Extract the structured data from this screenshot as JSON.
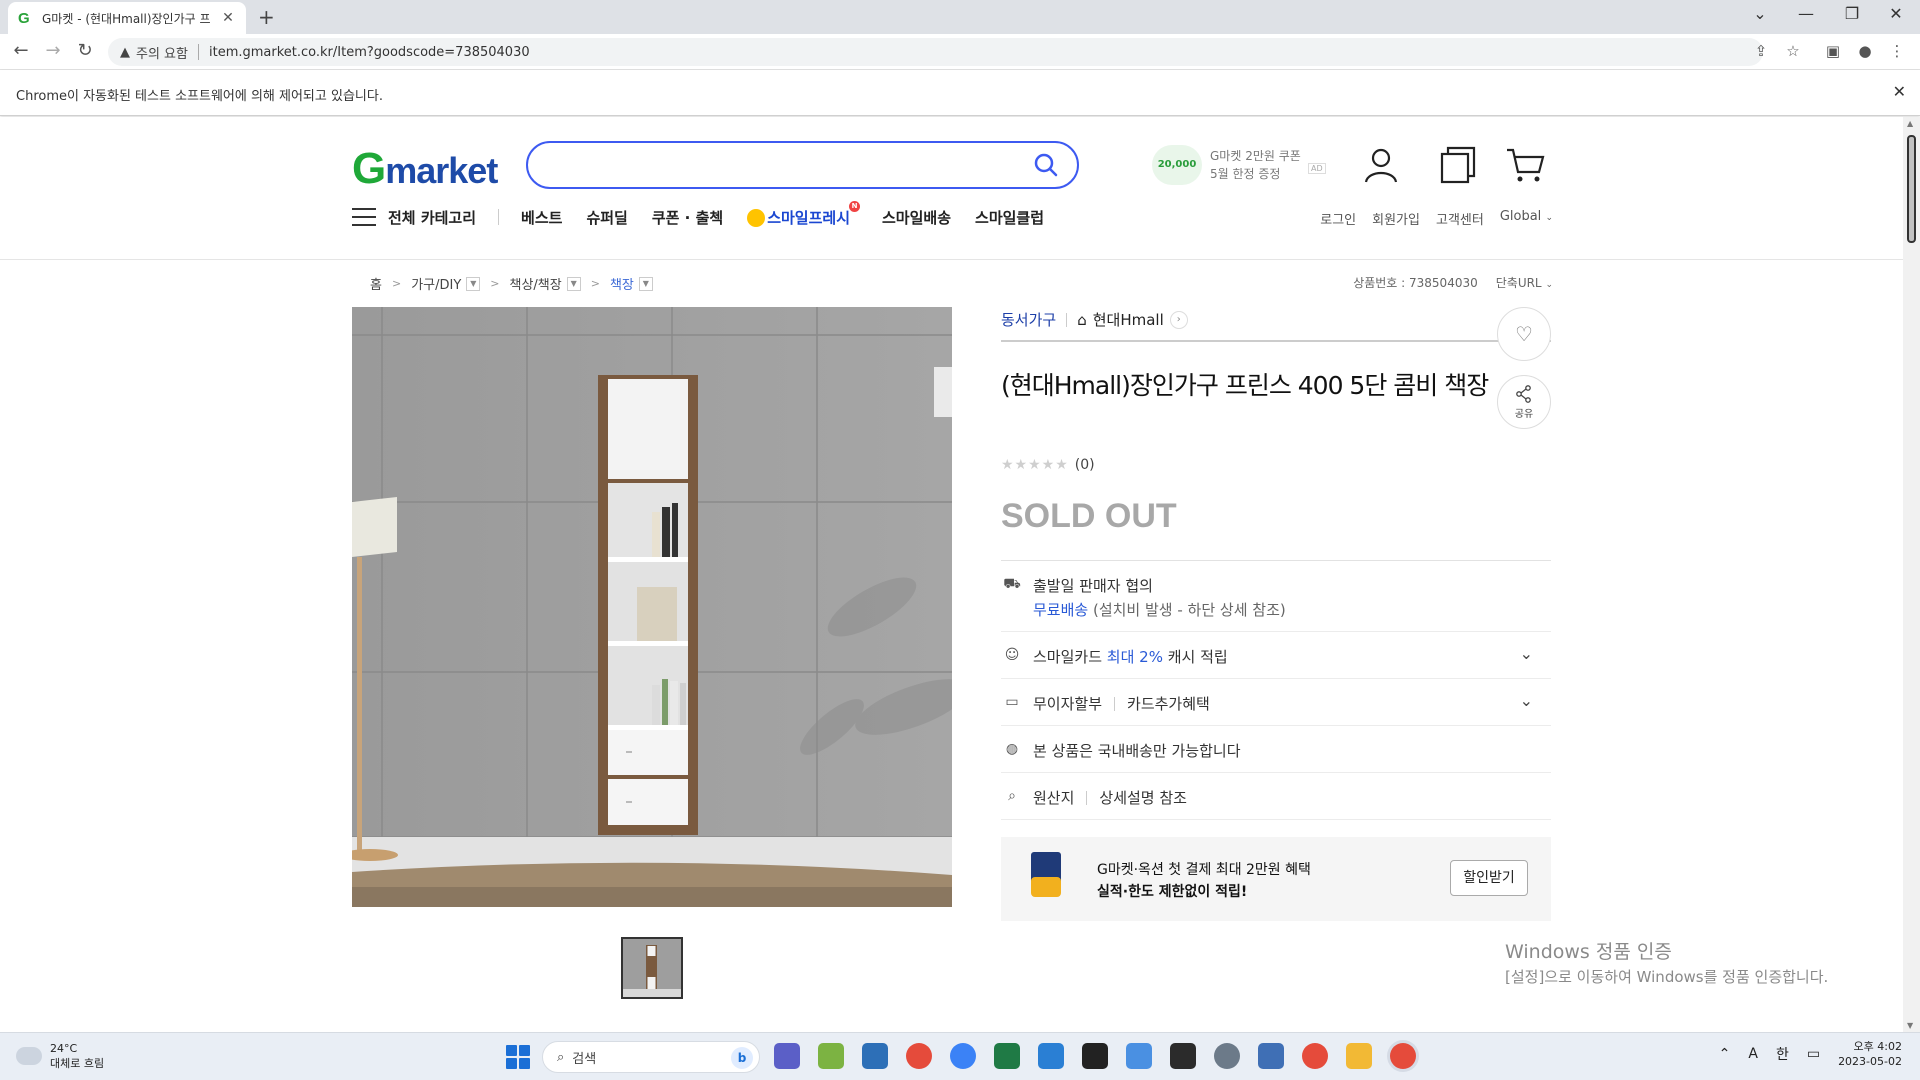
{
  "browser": {
    "tab_title": "G마켓 - (현대Hmall)장인가구 프",
    "favicon": "G",
    "new_tab": "+",
    "warning_label": "주의 요함",
    "url": "item.gmarket.co.kr/Item?goodscode=738504030",
    "automation_notice": "Chrome이 자동화된 테스트 소프트웨어에 의해 제어되고 있습니다."
  },
  "header": {
    "logo_g": "G",
    "logo_rest": "market",
    "search_placeholder": "",
    "coupon_amount": "20,000",
    "coupon_line1": "G마켓 2만원 쿠폰",
    "coupon_line2": "5월 한정 증정",
    "ad_badge": "AD"
  },
  "gnb": {
    "all_categories": "전체 카테고리",
    "items": [
      "베스트",
      "슈퍼딜",
      "쿠폰 · 출첵",
      "스마일프레시",
      "스마일배송",
      "스마일클럽"
    ],
    "new_badge": "N"
  },
  "util_links": [
    "로그인",
    "회원가입",
    "고객센터",
    "Global"
  ],
  "breadcrumb": {
    "home": "홈",
    "level1": "가구/DIY",
    "level2": "책상/책장",
    "level3": "책장"
  },
  "product_meta": {
    "product_number": "상품번호 : 738504030",
    "short_url": "단축URL"
  },
  "seller": {
    "category": "동서가구",
    "shop": "현대Hmall"
  },
  "product": {
    "title": "(현대Hmall)장인가구 프린스 400 5단 콤비 책장",
    "review_count": "(0)",
    "rating_stars": 0,
    "status": "SOLD OUT",
    "share_label": "공유"
  },
  "info_rows": {
    "shipping_line1": "출발일 판매자 협의",
    "shipping_free": "무료배송",
    "shipping_note": "(설치비 발생 - 하단 상세 참조)",
    "card_prefix": "스마일카드",
    "card_highlight": "최대 2%",
    "card_suffix": "캐시 적립",
    "installment": "무이자할부",
    "card_benefit": "카드추가혜택",
    "domestic_only": "본 상품은 국내배송만 가능합니다",
    "origin_label": "원산지",
    "origin_value": "상세설명 참조"
  },
  "banner": {
    "line1": "G마켓·옥션 첫 결제 최대 2만원 혜택",
    "line2": "실적·한도 제한없이 적립!",
    "button": "할인받기"
  },
  "watermark": {
    "line1": "Windows 정품 인증",
    "line2": "[설정]으로 이동하여 Windows를 정품 인증합니다."
  },
  "taskbar": {
    "temp": "24°C",
    "weather": "대체로 흐림",
    "search": "검색",
    "ime1": "A",
    "ime2": "한",
    "time": "오후 4:02",
    "date": "2023-05-02"
  },
  "colors": {
    "accent_blue": "#3d5af1",
    "gmarket_green": "#1fa838",
    "gmarket_blue": "#1e4ba8",
    "sold_out_gray": "#a8a8a8"
  }
}
